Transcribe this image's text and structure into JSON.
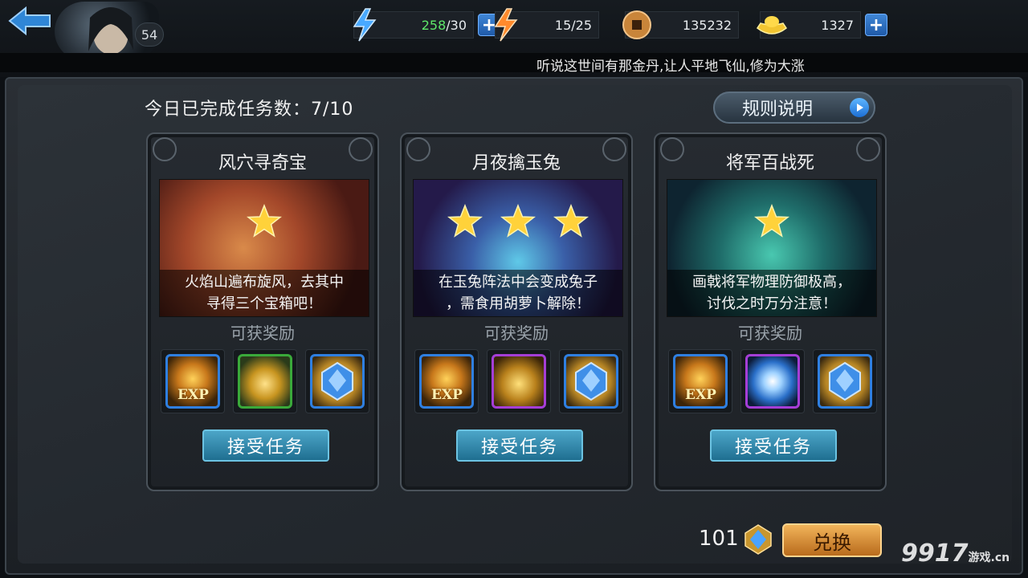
{
  "header": {
    "level": "54",
    "stamina": {
      "current": "258",
      "max": "/30"
    },
    "vitality": {
      "value": "15/25"
    },
    "copper": "135232",
    "gold": "1327",
    "marquee": "听说这世间有那金丹,让人平地飞仙,修为大涨"
  },
  "main": {
    "completed_label": "今日已完成任务数：7/10",
    "rules_label": "规则说明",
    "reward_label": "可获奖励",
    "accept_label": "接受任务",
    "cards": [
      {
        "title": "风穴寻奇宝",
        "stars": 1,
        "desc_line1": "火焰山遍布旋风，去其中",
        "desc_line2": "寻得三个宝箱吧！",
        "rewards": [
          "exp-icon",
          "gold-coins-icon",
          "jade-gem-icon"
        ]
      },
      {
        "title": "月夜擒玉兔",
        "stars": 3,
        "desc_line1": "在玉兔阵法中会变成兔子",
        "desc_line2": "，需食用胡萝卜解除！",
        "rewards": [
          "exp-icon",
          "treasure-bag-icon",
          "jade-gem-icon"
        ]
      },
      {
        "title": "将军百战死",
        "stars": 1,
        "desc_line1": "画戟将军物理防御极高，",
        "desc_line2": "讨伐之时万分注意！",
        "rewards": [
          "exp-icon",
          "spirit-orb-icon",
          "jade-gem-icon"
        ]
      }
    ],
    "exp_text": "EXP"
  },
  "footer": {
    "jade_count": "101",
    "exchange_label": "兑换",
    "watermark": "9917",
    "watermark_suffix": "游戏",
    "watermark_domain": ".cn"
  },
  "colors": {
    "accent_blue": "#2f7fe0",
    "accept_button": "#1f6f91",
    "exchange_button": "#b86b1c",
    "stamina_green": "#5ee76a"
  }
}
